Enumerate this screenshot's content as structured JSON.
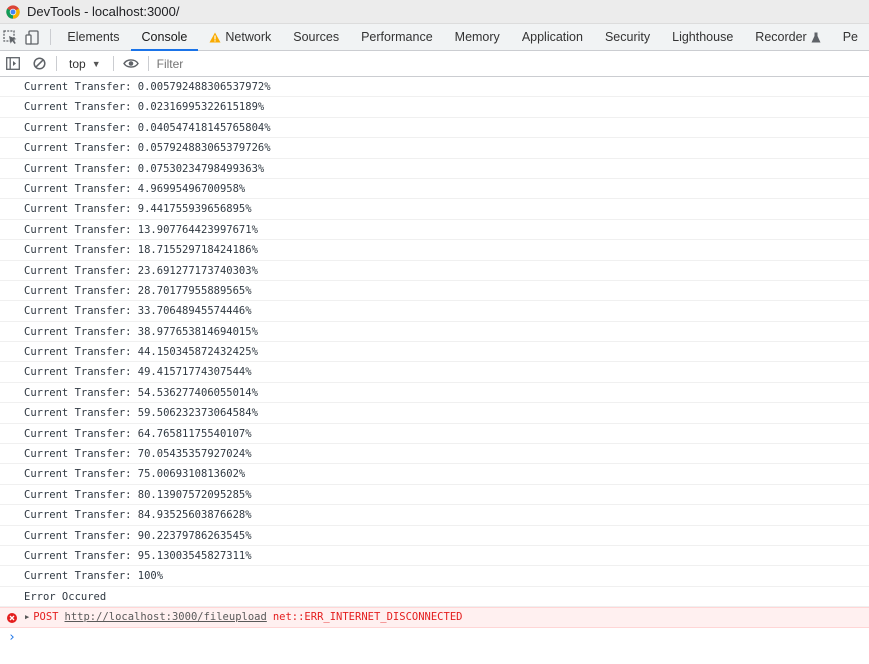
{
  "window": {
    "title": "DevTools - localhost:3000/"
  },
  "tabs": [
    "Elements",
    "Console",
    "Network",
    "Sources",
    "Performance",
    "Memory",
    "Application",
    "Security",
    "Lighthouse",
    "Recorder",
    "Pe"
  ],
  "active_tab": "Console",
  "toolbar": {
    "context": "top",
    "filter_placeholder": "Filter"
  },
  "console": {
    "lines": [
      "Current Transfer: 0.005792488306537972%",
      "Current Transfer: 0.02316995322615189%",
      "Current Transfer: 0.040547418145765804%",
      "Current Transfer: 0.057924883065379726%",
      "Current Transfer: 0.07530234798499363%",
      "Current Transfer: 4.96995496700958%",
      "Current Transfer: 9.441755939656895%",
      "Current Transfer: 13.907764423997671%",
      "Current Transfer: 18.715529718424186%",
      "Current Transfer: 23.691277173740303%",
      "Current Transfer: 28.70177955889565%",
      "Current Transfer: 33.70648945574446%",
      "Current Transfer: 38.977653814694015%",
      "Current Transfer: 44.150345872432425%",
      "Current Transfer: 49.41571774307544%",
      "Current Transfer: 54.536277406055014%",
      "Current Transfer: 59.506232373064584%",
      "Current Transfer: 64.76581175540107%",
      "Current Transfer: 70.05435357927024%",
      "Current Transfer: 75.0069310813602%",
      "Current Transfer: 80.13907572095285%",
      "Current Transfer: 84.93525603876628%",
      "Current Transfer: 90.22379786263545%",
      "Current Transfer: 95.13003545827311%",
      "Current Transfer: 100%",
      "Error Occured"
    ],
    "error": {
      "method": "POST",
      "url": "http://localhost:3000/fileupload",
      "message": "net::ERR_INTERNET_DISCONNECTED"
    },
    "prompt": "›"
  },
  "colors": {
    "accent": "#1a73e8",
    "error": "#e41e1e",
    "error_bg": "#fff0f0"
  }
}
